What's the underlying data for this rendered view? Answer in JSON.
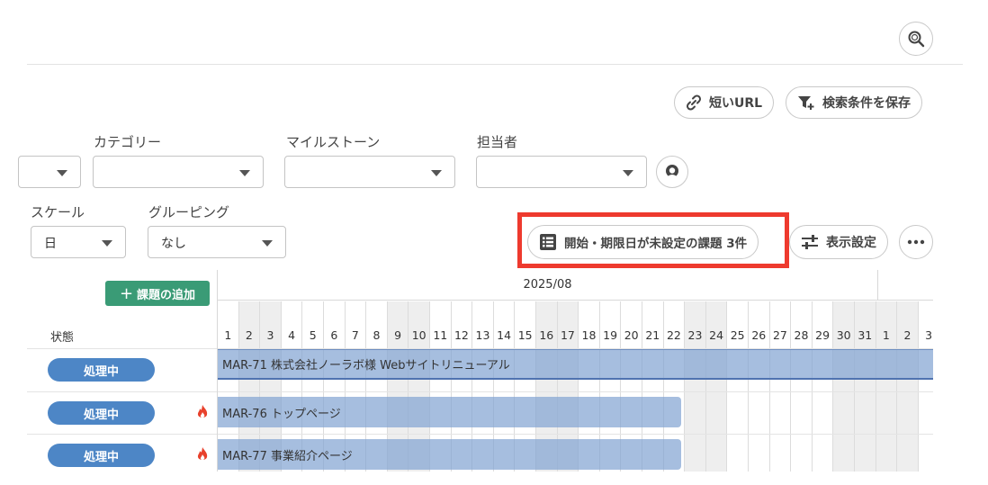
{
  "toolbar": {
    "short_url_label": "短いURL",
    "save_filter_label": "検索条件を保存"
  },
  "filters": {
    "category_label": "カテゴリー",
    "milestone_label": "マイルストーン",
    "assignee_label": "担当者",
    "category_value": "",
    "milestone_value": "",
    "assignee_value": "",
    "scale_label": "スケール",
    "scale_value": "日",
    "grouping_label": "グルーピング",
    "grouping_value": "なし"
  },
  "actions": {
    "unset_dates_label": "開始・期限日が未設定の課題 3件",
    "display_settings_label": "表示設定",
    "add_issue_label": "課題の追加"
  },
  "gantt": {
    "month_label": "2025/08",
    "days": [
      "1",
      "2",
      "3",
      "4",
      "5",
      "6",
      "7",
      "8",
      "9",
      "10",
      "11",
      "12",
      "13",
      "14",
      "15",
      "16",
      "17",
      "18",
      "19",
      "20",
      "21",
      "22",
      "23",
      "24",
      "25",
      "26",
      "27",
      "28",
      "29",
      "30",
      "31",
      "1",
      "2",
      "3"
    ],
    "status_header": "状態",
    "rows": [
      {
        "status": "処理中",
        "title": "MAR-71  株式会社ノーラボ様 Webサイトリニューアル",
        "hot": false
      },
      {
        "status": "処理中",
        "title": "MAR-76  トップページ",
        "hot": true
      },
      {
        "status": "処理中",
        "title": "MAR-77  事業紹介ページ",
        "hot": true
      }
    ]
  },
  "colors": {
    "accent_green": "#3a9b76",
    "status_blue": "#4d86c6",
    "highlight_red": "#ee3a2e",
    "bar_blue": "#83a5d2"
  }
}
